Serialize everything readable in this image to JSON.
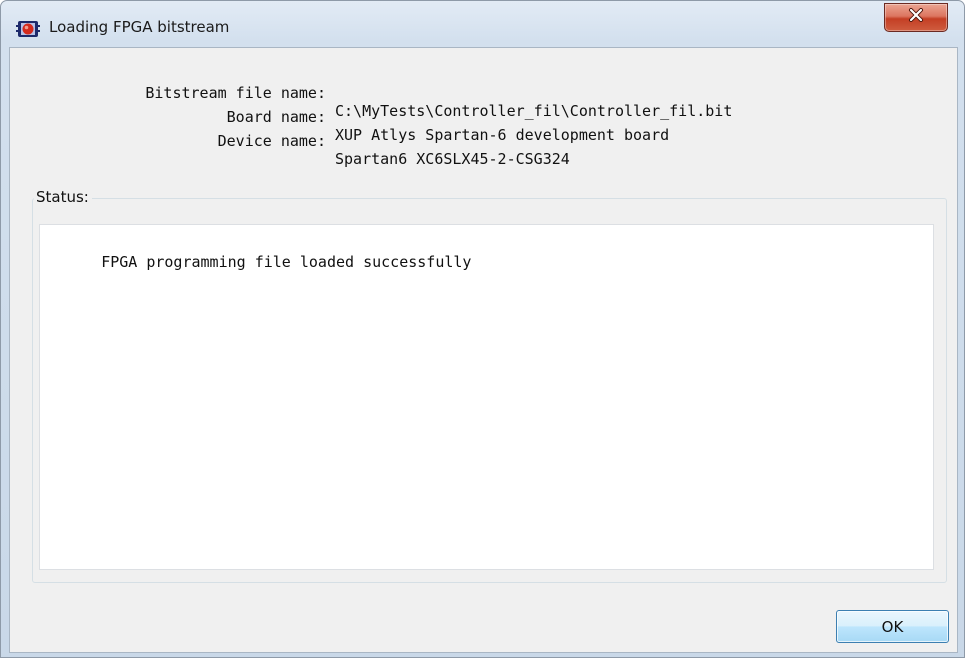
{
  "window": {
    "title": "Loading FPGA bitstream",
    "icon": "fpga-app-icon",
    "close_icon": "close-icon"
  },
  "info": {
    "bitstream_label": "Bitstream file name:",
    "bitstream_value": "C:\\MyTests\\Controller_fil\\Controller_fil.bit",
    "board_label": "Board name:",
    "board_value": "XUP Atlys Spartan-6 development board",
    "device_label": "Device name:",
    "device_value": "Spartan6 XC6SLX45-2-CSG324"
  },
  "status": {
    "label": "Status:",
    "message": "FPGA programming file loaded successfully"
  },
  "buttons": {
    "ok_label": "OK"
  },
  "colors": {
    "close_button": "#c94a30",
    "ok_button_border": "#3c7fb1",
    "window_frame": "#c9d8e8",
    "dialog_background": "#f0f0f0"
  }
}
